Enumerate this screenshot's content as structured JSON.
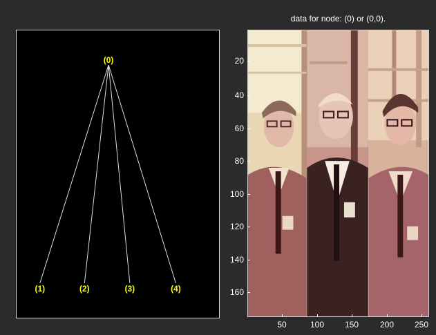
{
  "tree": {
    "root_label": "(0)",
    "children": [
      "(1)",
      "(2)",
      "(3)",
      "(4)"
    ],
    "line_color": "#e0e0e0",
    "label_color": "#ffff00"
  },
  "image_view": {
    "title": "data for node: (0) or (0,0).",
    "y_ticks": [
      "20",
      "40",
      "60",
      "80",
      "100",
      "120",
      "140",
      "160"
    ],
    "x_ticks": [
      "50",
      "100",
      "150",
      "200",
      "250"
    ],
    "palette": {
      "light": "#f6ead0",
      "mid": "#c89a86",
      "dark": "#3a1a1a",
      "rose": "#b57a78"
    }
  }
}
